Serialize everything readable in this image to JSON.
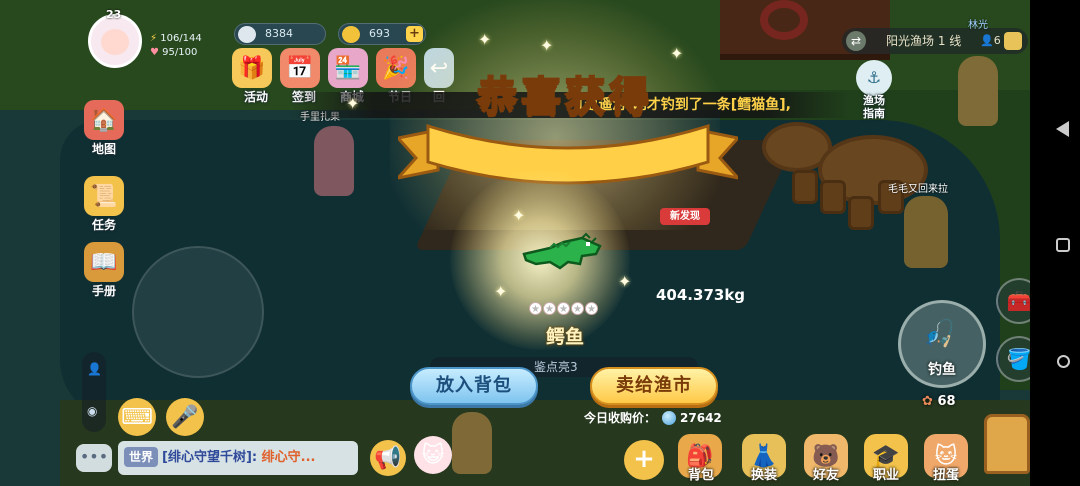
{
  "player": {
    "level": "23",
    "energy": "106/144",
    "stamina": "95/100"
  },
  "resources": {
    "shells": "8384",
    "coins": "693"
  },
  "top_menu": [
    {
      "label": "活动",
      "icon": "gift-icon"
    },
    {
      "label": "签到",
      "icon": "calendar-icon"
    },
    {
      "label": "商城",
      "icon": "shop-icon"
    },
    {
      "label": "节日",
      "icon": "festival-icon"
    },
    {
      "label": "回",
      "icon": "return-icon"
    }
  ],
  "left_menu": [
    {
      "label": "地图",
      "icon": "map-icon"
    },
    {
      "label": "任务",
      "icon": "task-icon"
    },
    {
      "label": "手册",
      "icon": "handbook-icon"
    }
  ],
  "farm": {
    "name": "阳光渔场 1 线",
    "players": "6"
  },
  "guide_label": "渔场\n指南",
  "chat_banner": "[逍遥游]刚才钓到了一条[鳕猫鱼],",
  "popup": {
    "title": "恭喜获得",
    "fish_name": "鳄鱼",
    "stars": 5,
    "new_badge": "新发现",
    "weight": "404.373kg",
    "btn_bag": "放入背包",
    "btn_sell": "卖给渔市",
    "price_label": "今日收购价：",
    "price_value": "27642",
    "hint": "鉴点亮3"
  },
  "npc_labels": [
    "手里扎果",
    "毛毛又回来拉",
    "林光"
  ],
  "chat": {
    "channel": "世界",
    "sender": "[绯心守望千树]:",
    "message": "绯心守..."
  },
  "bottom_menu": [
    {
      "label": "背包",
      "icon": "backpack-icon"
    },
    {
      "label": "换装",
      "icon": "wardrobe-icon"
    },
    {
      "label": "好友",
      "icon": "friends-icon"
    },
    {
      "label": "职业",
      "icon": "career-icon"
    },
    {
      "label": "扭蛋",
      "icon": "gacha-icon"
    }
  ],
  "fishing": {
    "label": "钓鱼",
    "bait_count": "68"
  },
  "colors": {
    "gold": "#ffb43a",
    "accent_blue": "#7fc4ef",
    "accent_yellow": "#ffc947",
    "badge_red": "#d93a3a"
  }
}
